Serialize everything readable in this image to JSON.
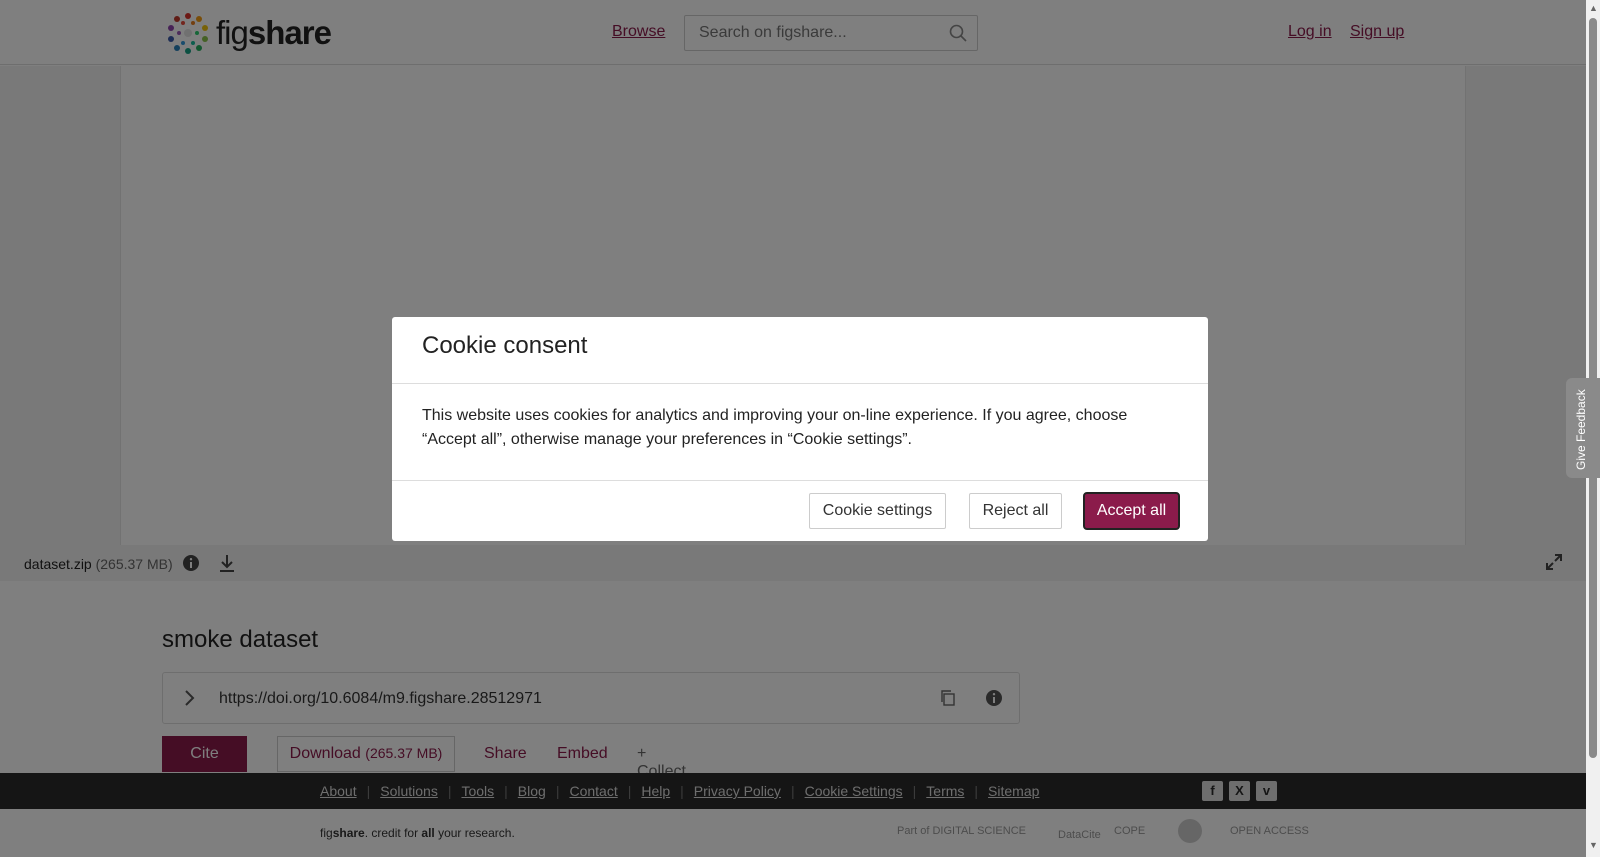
{
  "header": {
    "logo_text_light": "fig",
    "logo_text_bold": "share",
    "browse_label": "Browse",
    "search_placeholder": "Search on figshare...",
    "login_label": "Log in",
    "signup_label": "Sign up"
  },
  "file": {
    "name": "dataset.zip",
    "size": "(265.37 MB)"
  },
  "item": {
    "title": "smoke dataset",
    "doi": "https://doi.org/10.6084/m9.figshare.28512971"
  },
  "actions": {
    "cite": "Cite",
    "download": "Download",
    "download_size": "(265.37 MB)",
    "share": "Share",
    "embed": "Embed",
    "collect": "+ Collect"
  },
  "footer": {
    "links": [
      "About",
      "Solutions",
      "Tools",
      "Blog",
      "Contact",
      "Help",
      "Privacy Policy",
      "Cookie Settings",
      "Terms",
      "Sitemap"
    ],
    "tagline_fig": "fig",
    "tagline_share": "share",
    "tagline_mid": ". credit for ",
    "tagline_all": "all",
    "tagline_end": " your research.",
    "partners": [
      "Part of DIGITAL SCIENCE",
      "DataCite",
      "COPE",
      "",
      "OPEN ACCESS"
    ]
  },
  "feedback": {
    "label": "Give Feedback"
  },
  "modal": {
    "title": "Cookie consent",
    "body": "This website uses cookies for analytics and improving your on-line experience. If you agree, choose “Accept all”, otherwise manage your preferences in “Cookie settings”.",
    "settings_label": "Cookie settings",
    "reject_label": "Reject all",
    "accept_label": "Accept all"
  },
  "colors": {
    "accent": "#8b1b4b",
    "footer_bg": "#2b2b2b"
  }
}
